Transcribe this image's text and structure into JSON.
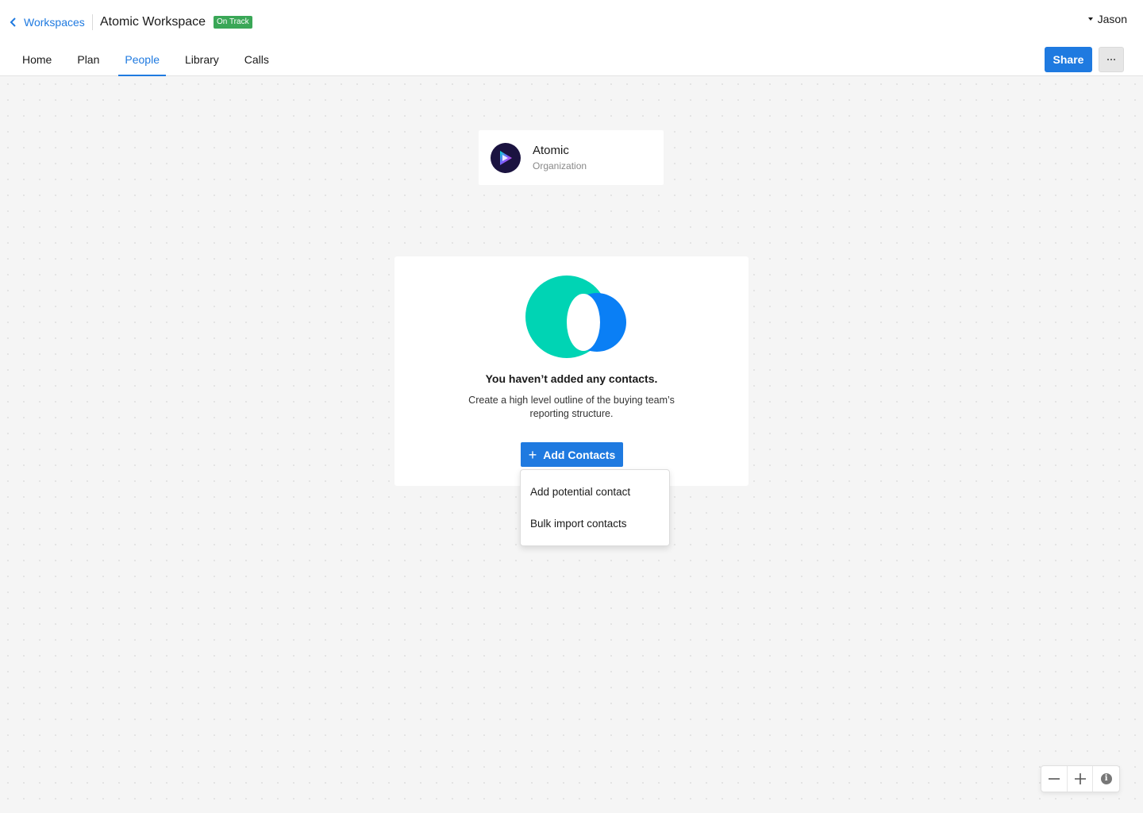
{
  "header": {
    "back_label": "Workspaces",
    "workspace_title": "Atomic Workspace",
    "status_badge": "On Track",
    "user_name": "Jason",
    "tabs": [
      {
        "label": "Home",
        "active": false
      },
      {
        "label": "Plan",
        "active": false
      },
      {
        "label": "People",
        "active": true
      },
      {
        "label": "Library",
        "active": false
      },
      {
        "label": "Calls",
        "active": false
      }
    ],
    "share_label": "Share"
  },
  "org_card": {
    "name": "Atomic",
    "type": "Organization"
  },
  "empty_state": {
    "title": "You haven’t added any contacts.",
    "description": "Create a high level outline of the buying team’s reporting structure.",
    "add_button_label": "Add Contacts"
  },
  "dropdown": {
    "items": [
      "Add potential contact",
      "Bulk import contacts"
    ]
  },
  "zoom": {
    "icons": [
      "minus-icon",
      "plus-icon",
      "info-icon"
    ],
    "info_glyph": "i"
  },
  "colors": {
    "accent": "#1f7ae0",
    "status_green": "#3aa757",
    "illustration_teal": "#00d4b4",
    "illustration_blue": "#0a7ff5"
  }
}
